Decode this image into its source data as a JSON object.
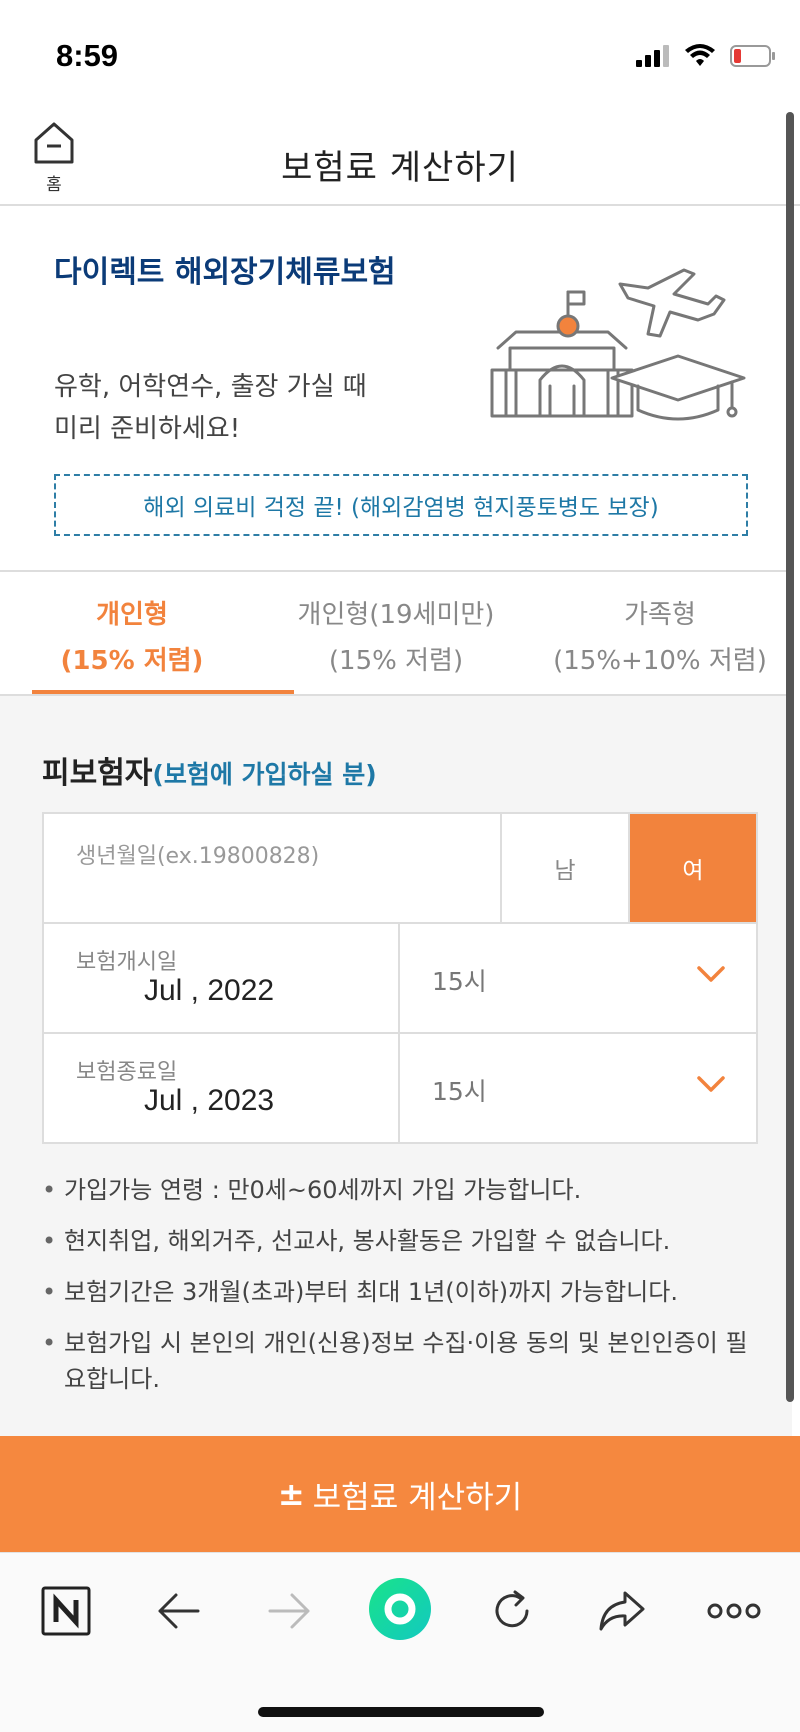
{
  "status_bar": {
    "time": "8:59"
  },
  "header": {
    "home_label": "홈",
    "title": "보험료 계산하기"
  },
  "hero": {
    "title": "다이렉트 해외장기체류보험",
    "subtitle_line1": "유학, 어학연수, 출장 가실 때",
    "subtitle_line2": "미리 준비하세요!",
    "notice": "해외 의료비 걱정 끝! (해외감염병 현지풍토병도 보장)"
  },
  "tabs": [
    {
      "line1": "개인형",
      "line2": "(15% 저렴)",
      "active": true
    },
    {
      "line1": "개인형(19세미만)",
      "line2": "(15% 저렴)",
      "active": false
    },
    {
      "line1": "가족형",
      "line2": "(15%+10% 저렴)",
      "active": false
    }
  ],
  "form": {
    "section_title": "피보험자",
    "section_sub": "(보험에 가입하실 분)",
    "birth_placeholder": "생년월일(ex.19800828)",
    "gender_male": "남",
    "gender_female": "여",
    "start_label": "보험개시일",
    "start_date": "Jul   , 2022",
    "start_time": "15시",
    "end_label": "보험종료일",
    "end_date": "Jul   , 2023",
    "end_time": "15시"
  },
  "notes": [
    "가입가능 연령 : 만0세~60세까지 가입 가능합니다.",
    "현지취업, 해외거주, 선교사, 봉사활동은 가입할 수 없습니다.",
    "보험기간은 3개월(초과)부터 최대 1년(이하)까지 가능합니다.",
    "보험가입 시 본인의 개인(신용)정보 수집·이용 동의 및 본인인증이 필요합니다."
  ],
  "calc_button": {
    "plus": "±",
    "label": "보험료 계산하기"
  },
  "colors": {
    "accent": "#f2833d",
    "navy": "#0b3b78",
    "link_blue": "#1e78a6"
  },
  "browser_icons": [
    "naver-n-icon",
    "back-arrow-icon",
    "forward-arrow-icon",
    "green-home-icon",
    "reload-icon",
    "share-icon",
    "more-icon"
  ]
}
